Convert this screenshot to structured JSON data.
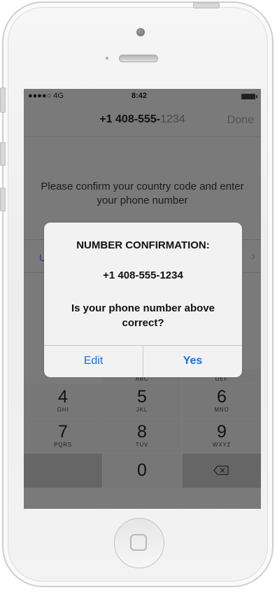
{
  "status_bar": {
    "signal": "●●●●○ 4G",
    "time": "8:42"
  },
  "nav": {
    "title_prefix": "+1 408-555-",
    "title_suffix": "1234",
    "done_label": "Done"
  },
  "instructions": "Please confirm your country code and enter your phone number",
  "background_fragments": {
    "left": "U",
    "right": "›"
  },
  "alert": {
    "title": "NUMBER CONFIRMATION:",
    "number": "+1 408-555-1234",
    "question": "Is your phone number above correct?",
    "edit_label": "Edit",
    "yes_label": "Yes"
  },
  "keypad": {
    "top_letters": [
      "ABC",
      "DEF"
    ],
    "row2": [
      {
        "num": "4",
        "letters": "GHI"
      },
      {
        "num": "5",
        "letters": "JKL"
      },
      {
        "num": "6",
        "letters": "MNO"
      }
    ],
    "row3": [
      {
        "num": "7",
        "letters": "PQRS"
      },
      {
        "num": "8",
        "letters": "TUV"
      },
      {
        "num": "9",
        "letters": "WXYZ"
      }
    ],
    "zero": "0",
    "delete_icon": "backspace-icon"
  },
  "colors": {
    "accent": "#1a6fe0",
    "overlay": "#7a7a7a",
    "alert_bg": "#f2f2f2"
  }
}
